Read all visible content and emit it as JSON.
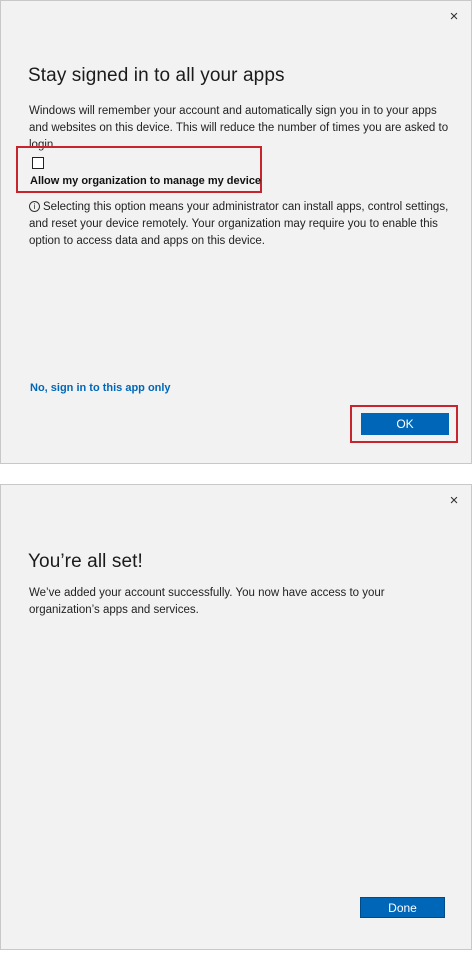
{
  "dialog1": {
    "close_icon": "×",
    "title": "Stay signed in to all your apps",
    "body": "Windows will remember your account and automatically sign you in to your apps and websites on this device. This will reduce the number of times you are asked to login.",
    "checkbox_label": "Allow my organization to manage my device",
    "checkbox_checked": false,
    "info_icon": "info-icon",
    "info_text": "Selecting this option means your administrator can install apps, control settings, and reset your device remotely. Your organization may require you to enable this option to access data and apps on this device.",
    "link": "No, sign in to this app only",
    "ok_button": "OK",
    "highlight_color": "#c8242e",
    "accent_color": "#0067b8"
  },
  "dialog2": {
    "close_icon": "×",
    "title": "You’re all set!",
    "body": "We’ve added your account successfully. You now have access to your organization’s apps and services.",
    "done_button": "Done"
  }
}
